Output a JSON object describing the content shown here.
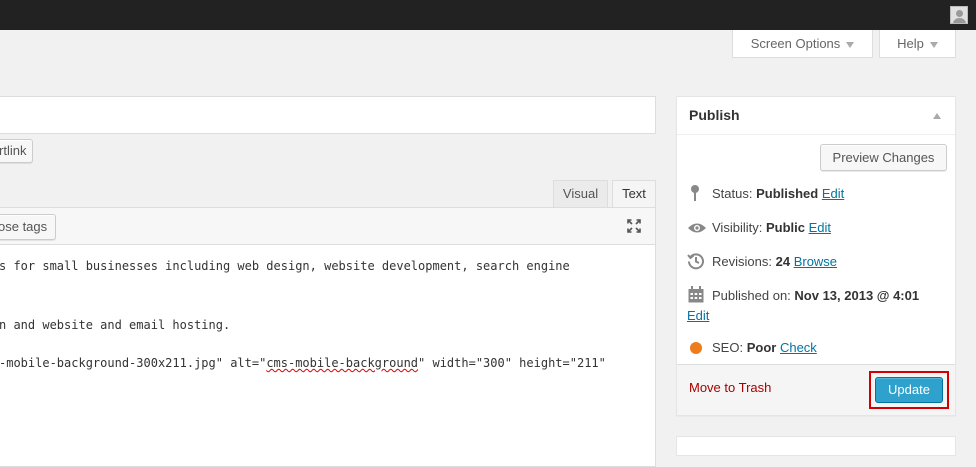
{
  "header": {
    "screen_options": "Screen Options",
    "help": "Help"
  },
  "editor": {
    "permalink_button_fragment": "rtlink",
    "tabs": {
      "visual": "Visual",
      "text": "Text"
    },
    "quicktag_fragment": "ose tags",
    "lines": [
      "s for small businesses including web design, website development, search engine",
      "n and website and email hosting.",
      "-mobile-background-300x211.jpg\" alt=\"",
      "cms-mobile-background",
      "\" width=\"300\" height=\"211\""
    ]
  },
  "publish": {
    "title": "Publish",
    "preview_button": "Preview Changes",
    "status": {
      "label": "Status:",
      "value": "Published",
      "link": "Edit"
    },
    "visibility": {
      "label": "Visibility:",
      "value": "Public",
      "link": "Edit"
    },
    "revisions": {
      "label": "Revisions:",
      "value": "24",
      "link": "Browse"
    },
    "published_on": {
      "label": "Published on:",
      "value": "Nov 13, 2013 @ 4:01",
      "link": "Edit"
    },
    "seo": {
      "label": "SEO:",
      "value": "Poor",
      "link": "Check",
      "color": "#ee7c1b"
    },
    "trash": "Move to Trash",
    "update": "Update"
  },
  "colors": {
    "admin_bar": "#222222",
    "primary_button": "#2ea2cc",
    "link": "#0074a2",
    "trash": "#aa0000",
    "highlight": "#d40000"
  }
}
